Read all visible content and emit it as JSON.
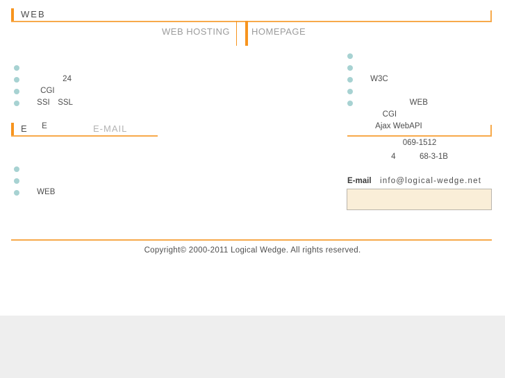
{
  "sections": {
    "web": {
      "title": "WEB",
      "tabs": [
        {
          "label": "WEB HOSTING"
        },
        {
          "label": "HOMEPAGE"
        }
      ],
      "left_items": [
        {
          "text": "24",
          "bullet": false
        },
        {
          "text": "CGI",
          "bullet": true
        },
        {
          "text": "SSI　SSL",
          "bullet": true
        },
        {
          "text": "",
          "bullet": true
        },
        {
          "text": "E",
          "bullet": true
        }
      ],
      "right_items": [
        {
          "text": "W3C",
          "bullet": true
        },
        {
          "text": "",
          "bullet": true
        },
        {
          "text": "　　　WEB",
          "bullet": true
        },
        {
          "text": "　CGI",
          "bullet": true
        },
        {
          "text": "Ajax WebAPI",
          "bullet": true
        }
      ]
    },
    "email": {
      "title": "E",
      "subtitle": "E-MAIL",
      "items": [
        {
          "text": "WEB",
          "bullet": true
        },
        {
          "text": "",
          "bullet": true
        },
        {
          "text": "",
          "bullet": true
        }
      ]
    },
    "contact": {
      "postal_code": "069-1512",
      "address": "4　　　68-3-1B",
      "email_label": "E-mail",
      "email_value": "info@logical-wedge.net"
    }
  },
  "footer": {
    "copyright": "Copyright© 2000-2011 Logical Wedge. All rights reserved."
  },
  "colors": {
    "accent_orange": "#f7941e",
    "rule_orange": "#f7a94a",
    "bullet_teal": "#a7d2d2",
    "mail_box_bg": "#faeed8",
    "text_gray": "#4d4d4d",
    "tab_gray": "#9c9c9c"
  }
}
